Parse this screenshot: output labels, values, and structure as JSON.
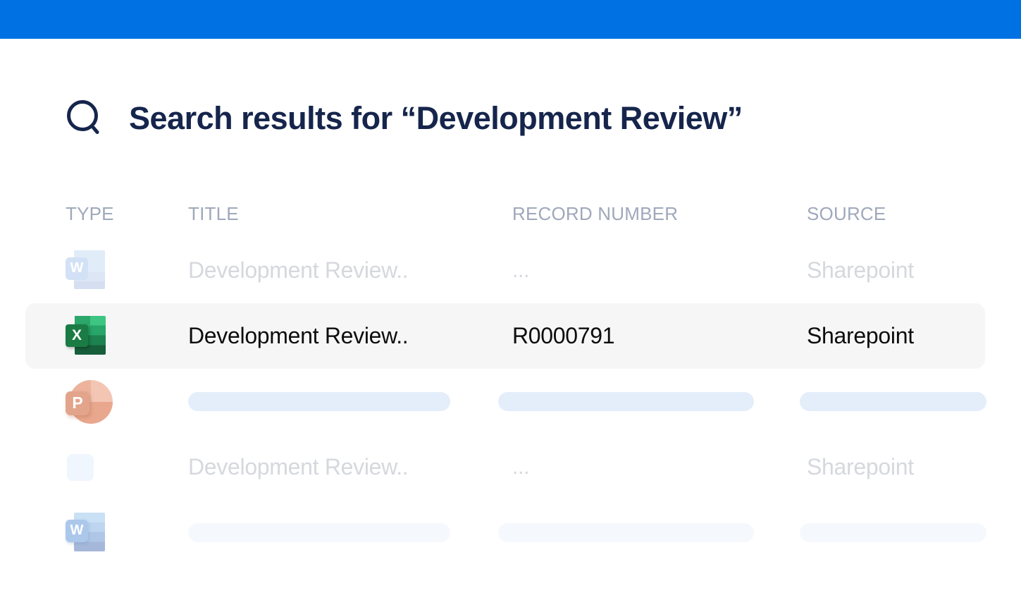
{
  "colors": {
    "topbar": "#0071E3",
    "title_navy": "#16254C",
    "selected_row_bg": "#F6F6F6",
    "placeholder_pill": "#E4EEFA",
    "placeholder_pill_faint": "#F5F9FD",
    "faded_text": "#D5D8DD",
    "header_text": "#9FA8BB"
  },
  "header": {
    "title": "Search results for “Development Review”"
  },
  "table": {
    "columns": [
      "TYPE",
      "TITLE",
      "RECORD NUMBER",
      "SOURCE"
    ],
    "rows": [
      {
        "file_type": "word",
        "icon_letter": "W",
        "title": "Development Review..",
        "record_number": "...",
        "source": "Sharepoint",
        "state": "faded"
      },
      {
        "file_type": "excel",
        "icon_letter": "X",
        "title": "Development Review..",
        "record_number": "R0000791",
        "source": "Sharepoint",
        "state": "selected"
      },
      {
        "file_type": "powerpoint",
        "icon_letter": "P",
        "title": "",
        "record_number": "",
        "source": "",
        "state": "placeholder"
      },
      {
        "file_type": "none",
        "icon_letter": "",
        "title": "Development Review..",
        "record_number": "...",
        "source": "Sharepoint",
        "state": "faded"
      },
      {
        "file_type": "word",
        "icon_letter": "W",
        "title": "",
        "record_number": "",
        "source": "",
        "state": "placeholder-faint"
      }
    ]
  }
}
